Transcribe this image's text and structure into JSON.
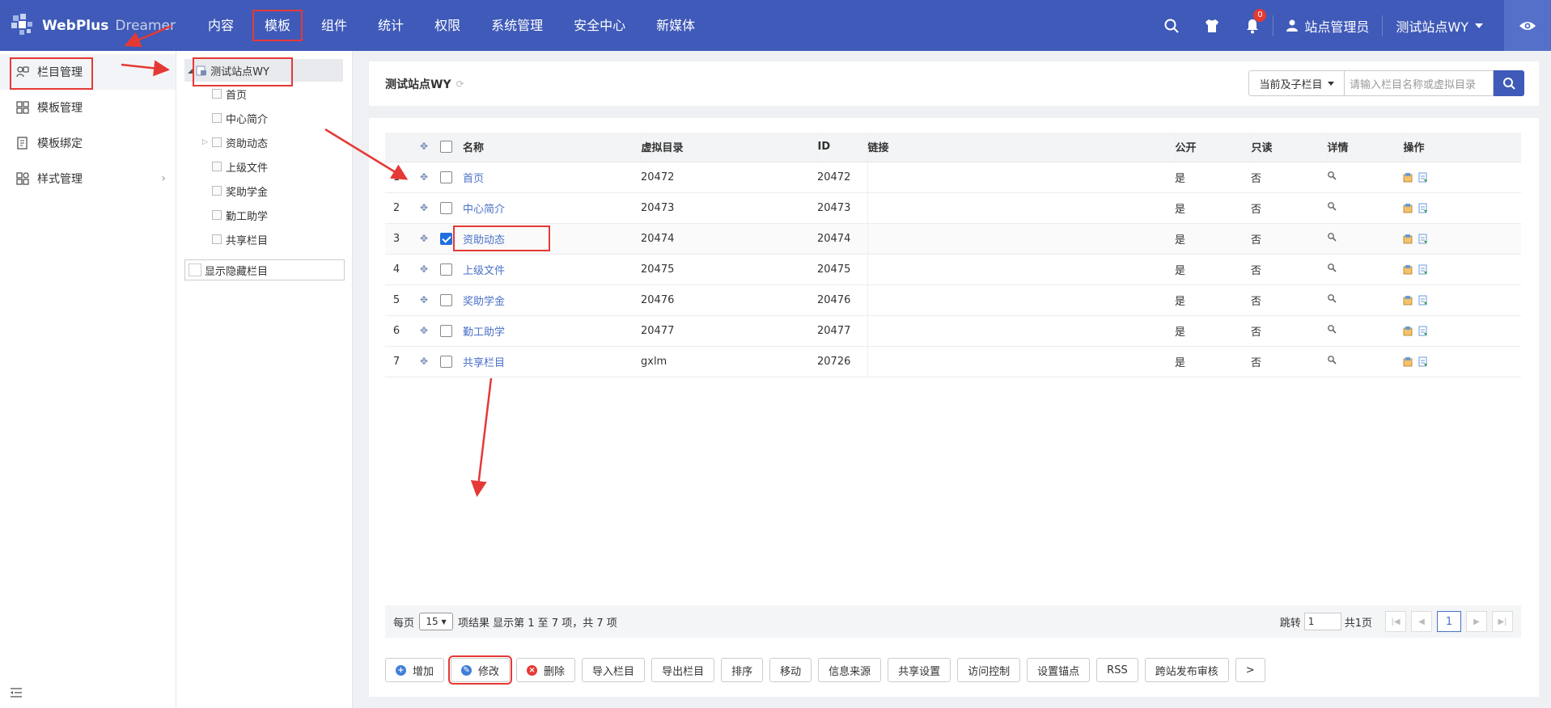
{
  "logo": {
    "brand": "WebPlus",
    "sub": "Dreamer"
  },
  "nav": [
    "内容",
    "模板",
    "组件",
    "统计",
    "权限",
    "系统管理",
    "安全中心",
    "新媒体"
  ],
  "topbar": {
    "badge": "0",
    "user": "站点管理员",
    "site": "测试站点WY"
  },
  "sidebar": {
    "items": [
      {
        "label": "栏目管理"
      },
      {
        "label": "模板管理"
      },
      {
        "label": "模板绑定"
      },
      {
        "label": "样式管理"
      }
    ]
  },
  "tree": {
    "root": "测试站点WY",
    "nodes": [
      "首页",
      "中心简介",
      "资助动态",
      "上级文件",
      "奖助学金",
      "勤工助学",
      "共享栏目"
    ],
    "show_hidden": "显示隐藏栏目"
  },
  "header": {
    "title": "测试站点WY",
    "scope": "当前及子栏目",
    "search_placeholder": "请输入栏目名称或虚拟目录"
  },
  "table": {
    "columns": [
      "名称",
      "虚拟目录",
      "ID",
      "链接",
      "公开",
      "只读",
      "详情",
      "操作"
    ],
    "rows": [
      {
        "num": "1",
        "name": "首页",
        "dir": "20472",
        "id": "20472",
        "public": "是",
        "readonly": "否",
        "checked": false
      },
      {
        "num": "2",
        "name": "中心简介",
        "dir": "20473",
        "id": "20473",
        "public": "是",
        "readonly": "否",
        "checked": false
      },
      {
        "num": "3",
        "name": "资助动态",
        "dir": "20474",
        "id": "20474",
        "public": "是",
        "readonly": "否",
        "checked": true
      },
      {
        "num": "4",
        "name": "上级文件",
        "dir": "20475",
        "id": "20475",
        "public": "是",
        "readonly": "否",
        "checked": false
      },
      {
        "num": "5",
        "name": "奖助学金",
        "dir": "20476",
        "id": "20476",
        "public": "是",
        "readonly": "否",
        "checked": false
      },
      {
        "num": "6",
        "name": "勤工助学",
        "dir": "20477",
        "id": "20477",
        "public": "是",
        "readonly": "否",
        "checked": false
      },
      {
        "num": "7",
        "name": "共享栏目",
        "dir": "gxlm",
        "id": "20726",
        "public": "是",
        "readonly": "否",
        "checked": false
      }
    ]
  },
  "pager": {
    "per_page": "每页",
    "size": "15",
    "info": "项结果 显示第 1 至 7 项，共 7 项",
    "jump": "跳转",
    "jump_value": "1",
    "total": "共1页",
    "current": "1"
  },
  "actions": [
    {
      "label": "增加",
      "icon": "plus-icon",
      "color": "#3f7fd8"
    },
    {
      "label": "修改",
      "icon": "edit-icon",
      "color": "#3f7fd8"
    },
    {
      "label": "删除",
      "icon": "delete-icon",
      "color": "#e53935"
    },
    {
      "label": "导入栏目"
    },
    {
      "label": "导出栏目"
    },
    {
      "label": "排序"
    },
    {
      "label": "移动"
    },
    {
      "label": "信息来源"
    },
    {
      "label": "共享设置"
    },
    {
      "label": "访问控制"
    },
    {
      "label": "设置锚点"
    },
    {
      "label": "RSS"
    },
    {
      "label": "跨站发布审核"
    },
    {
      "label": ">"
    }
  ],
  "colors": {
    "topbar": "#3f5ab8",
    "accent": "#4a70c9",
    "highlight": "#e53935"
  }
}
